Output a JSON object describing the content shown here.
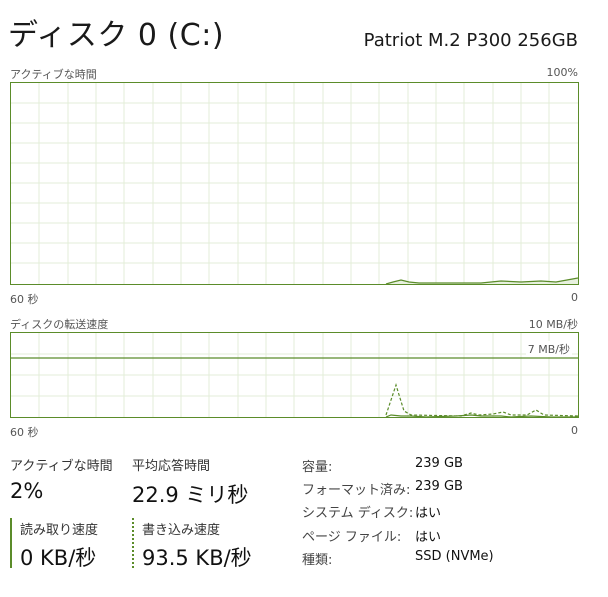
{
  "header": {
    "title": "ディスク 0 (C:)",
    "model": "Patriot M.2 P300 256GB"
  },
  "active_time_chart": {
    "label": "アクティブな時間",
    "max_label": "100%",
    "x_left_label": "60 秒",
    "x_right_label": "0"
  },
  "transfer_chart": {
    "label": "ディスクの転送速度",
    "max_label": "10 MB/秒",
    "ref_line_label": "7 MB/秒",
    "x_left_label": "60 秒",
    "x_right_label": "0"
  },
  "stats": {
    "active_time": {
      "label": "アクティブな時間",
      "value": "2%"
    },
    "avg_response": {
      "label": "平均応答時間",
      "value": "22.9 ミリ秒"
    },
    "read_speed": {
      "label": "読み取り速度",
      "value": "0 KB/秒"
    },
    "write_speed": {
      "label": "書き込み速度",
      "value": "93.5 KB/秒"
    }
  },
  "properties": [
    {
      "key": "容量:",
      "value": "239 GB"
    },
    {
      "key": "フォーマット済み:",
      "value": "239 GB"
    },
    {
      "key": "システム ディスク:",
      "value": "はい"
    },
    {
      "key": "ページ ファイル:",
      "value": "はい"
    },
    {
      "key": "種類:",
      "value": "SSD (NVMe)"
    }
  ],
  "colors": {
    "accent": "#5b8c2a",
    "grid": "#e3eed8",
    "fill": "#e8f1df"
  }
}
